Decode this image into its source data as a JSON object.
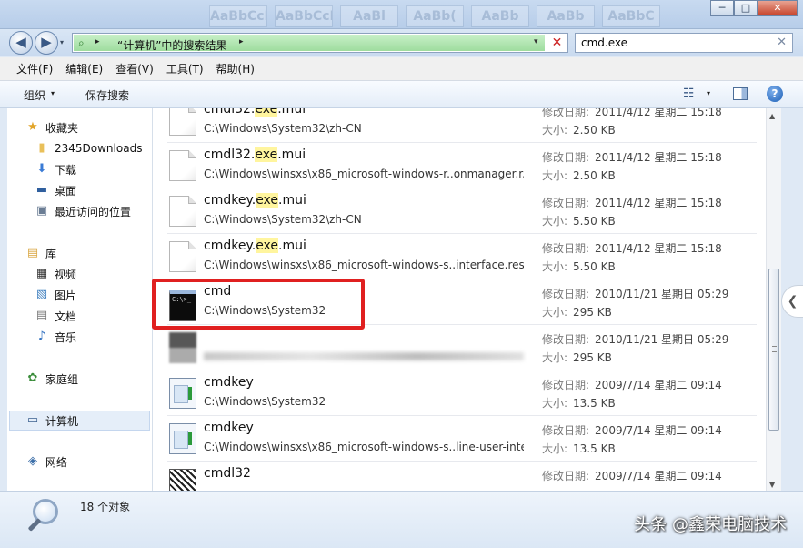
{
  "window": {
    "controls": {
      "minimize": "─",
      "maximize": "□",
      "close": "✕"
    },
    "ribbon_ghosts": [
      "AaBbCcDd",
      "AaBbCcDd",
      "AaBl",
      "AaBb(",
      "AaBb",
      "AaBb",
      "AaBbC"
    ]
  },
  "address": {
    "path": "“计算机”中的搜索结果",
    "back_glyph": "◀",
    "forward_glyph": "▶",
    "separator_glyph": "▸",
    "dropdown_glyph": "▾",
    "clear_glyph": "✕"
  },
  "search": {
    "value": "cmd.exe",
    "clear_glyph": "✕"
  },
  "menu": [
    "文件(F)",
    "编辑(E)",
    "查看(V)",
    "工具(T)",
    "帮助(H)"
  ],
  "toolbar": {
    "organize": "组织",
    "save_search": "保存搜索",
    "dropdown_glyph": "▾",
    "help_glyph": "?",
    "view_glyph": "☷"
  },
  "nav": {
    "favorites": "收藏夹",
    "fav_items": [
      "2345Downloads",
      "下载",
      "桌面",
      "最近访问的位置"
    ],
    "libraries": "库",
    "lib_items": [
      "视频",
      "图片",
      "文档",
      "音乐"
    ],
    "homegroup": "家庭组",
    "computer": "计算机",
    "network": "网络"
  },
  "labels": {
    "modified": "修改日期:",
    "size": "大小:"
  },
  "files": [
    {
      "name_pre": "cmdl32.",
      "name_hl": "exe",
      "name_post": ".mui",
      "path": "C:\\Windows\\System32\\zh-CN",
      "date": "2011/4/12 星期二 15:18",
      "size": "2.50 KB",
      "icon": "doc"
    },
    {
      "name_pre": "cmdl32.",
      "name_hl": "exe",
      "name_post": ".mui",
      "path": "C:\\Windows\\winsxs\\x86_microsoft-windows-r..onmanager.r...",
      "date": "2011/4/12 星期二 15:18",
      "size": "2.50 KB",
      "icon": "doc"
    },
    {
      "name_pre": "cmdkey.",
      "name_hl": "exe",
      "name_post": ".mui",
      "path": "C:\\Windows\\System32\\zh-CN",
      "date": "2011/4/12 星期二 15:18",
      "size": "5.50 KB",
      "icon": "doc"
    },
    {
      "name_pre": "cmdkey.",
      "name_hl": "exe",
      "name_post": ".mui",
      "path": "C:\\Windows\\winsxs\\x86_microsoft-windows-s..interface.reso...",
      "date": "2011/4/12 星期二 15:18",
      "size": "5.50 KB",
      "icon": "doc"
    },
    {
      "name_pre": "cmd",
      "name_hl": "",
      "name_post": "",
      "path": "C:\\Windows\\System32",
      "date": "2010/11/21 星期日 05:29",
      "size": "295 KB",
      "icon": "cmd",
      "icon_text": "C:\\>_"
    },
    {
      "name_pre": "",
      "name_hl": "",
      "name_post": "",
      "path": "",
      "date": "2010/11/21 星期日 05:29",
      "size": "295 KB",
      "icon": "blur"
    },
    {
      "name_pre": "cmdkey",
      "name_hl": "",
      "name_post": "",
      "path": "C:\\Windows\\System32",
      "date": "2009/7/14 星期二 09:14",
      "size": "13.5 KB",
      "icon": "app"
    },
    {
      "name_pre": "cmdkey",
      "name_hl": "",
      "name_post": "",
      "path": "C:\\Windows\\winsxs\\x86_microsoft-windows-s..line-user-inte...",
      "date": "2009/7/14 星期二 09:14",
      "size": "13.5 KB",
      "icon": "app"
    },
    {
      "name_pre": "cmdl32",
      "name_hl": "",
      "name_post": "",
      "path": "",
      "date": "2009/7/14 星期二 09:14",
      "size": "",
      "icon": "dll"
    }
  ],
  "status": {
    "count": "18 个对象"
  },
  "watermark": "头条 @鑫荣电脑技术",
  "scroll": {
    "up_glyph": "▲",
    "down_glyph": "▼",
    "collapse_glyph": "❮"
  },
  "colors": {
    "highlight": "#fff59e",
    "callout": "#e02020",
    "address_fill": "#9edc9e"
  }
}
